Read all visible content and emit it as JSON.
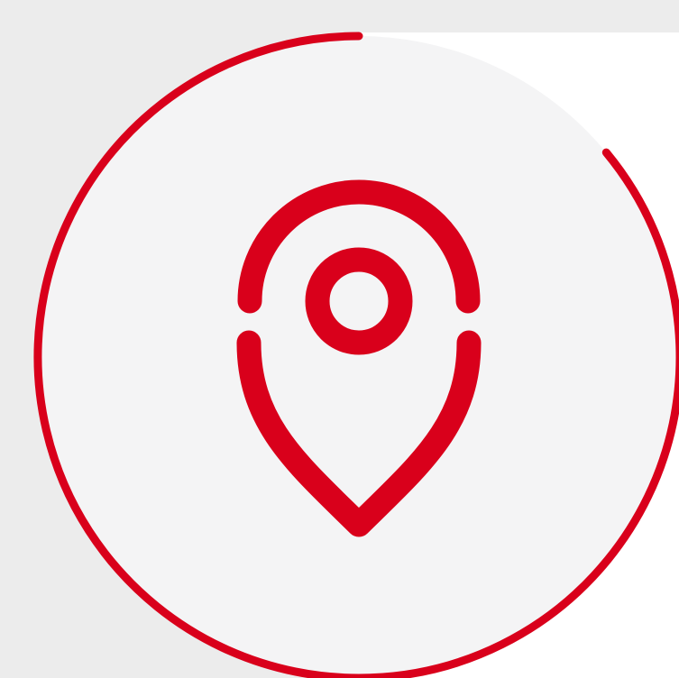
{
  "icon": {
    "name": "location-pin-icon"
  },
  "colors": {
    "accent": "#d9001b",
    "circle_fill": "#f4f4f5",
    "background": "#ececec",
    "page": "#ffffff"
  },
  "progress": {
    "fraction": 0.86
  }
}
